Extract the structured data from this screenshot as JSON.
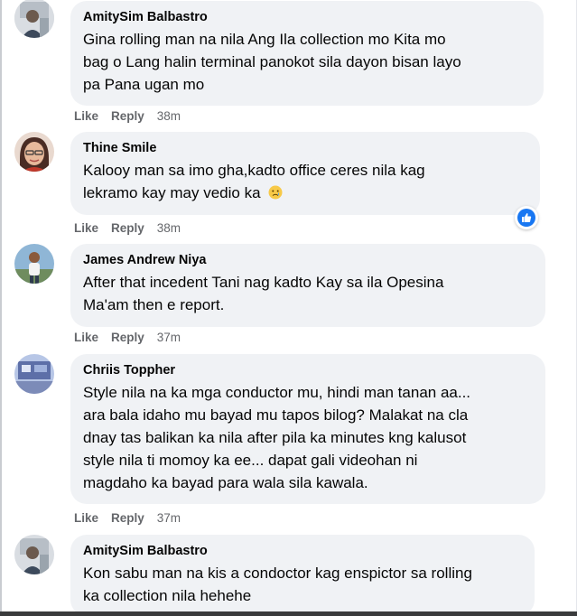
{
  "comments": [
    {
      "author": "AmitySim Balbastro",
      "lines": [
        "Gina rolling man na nila Ang Ila collection mo Kita mo",
        "bag o Lang halin terminal panokot sila dayon bisan layo",
        "pa Pana ugan mo"
      ],
      "like": "Like",
      "reply": "Reply",
      "time": "38m"
    },
    {
      "author": "Thine Smile",
      "lines": [
        "Kalooy man sa imo gha,kadto office ceres nila kag",
        "lekramo kay may vedio ka"
      ],
      "emoji_icon": "sad-face-emoji",
      "like": "Like",
      "reply": "Reply",
      "time": "38m",
      "reaction_icon": "like-reaction-icon"
    },
    {
      "author": "James Andrew Niya",
      "lines": [
        "After that incedent Tani nag kadto Kay sa ila Opesina",
        "Ma'am then e report."
      ],
      "like": "Like",
      "reply": "Reply",
      "time": "37m"
    },
    {
      "author": "Chriis Toppher",
      "lines": [
        "Style nila na ka mga conductor mu, hindi man tanan aa...",
        "ara bala idaho mu bayad mu tapos bilog? Malakat na cla",
        "dnay tas balikan ka nila after pila ka minutes kng kalusot",
        "style nila ti momoy ka ee... dapat gali videohan ni",
        "magdaho ka bayad para wala sila kawala."
      ],
      "like": "Like",
      "reply": "Reply",
      "time": "37m"
    },
    {
      "author": "AmitySim Balbastro",
      "lines": [
        "Kon sabu man na kis a condoctor kag enspictor sa rolling",
        "ka collection nila hehehe"
      ]
    }
  ],
  "colors": {
    "bubble": "#f0f2f5",
    "meta": "#65676b",
    "like_blue": "#1877f2"
  }
}
